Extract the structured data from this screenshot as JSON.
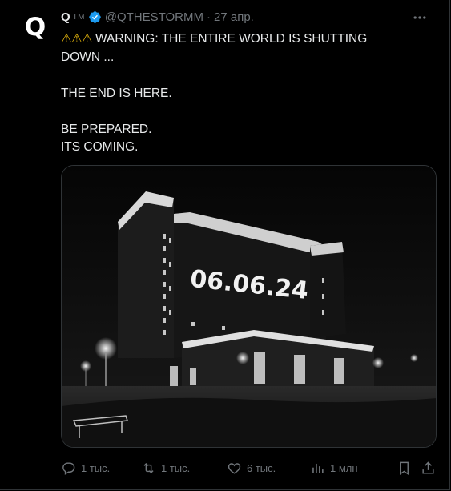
{
  "tweet": {
    "avatar_letter": "Q",
    "display_name": "Q",
    "name_suffix": "ТМ",
    "handle": "@QTHESTORMM",
    "separator": "·",
    "date": "27 апр.",
    "text_lines": [
      "WARNING: THE ENTIRE WORLD IS SHUTTING",
      "DOWN ...",
      "",
      "THE END IS HERE.",
      "",
      "BE PREPARED.",
      "ITS COMING."
    ],
    "warning_icons": "⚠⚠⚠",
    "image_projection_text": "06.06.24",
    "accent_color": "#1d9bf0"
  },
  "actions": {
    "replies": {
      "icon": "reply-icon",
      "count": "1 тыс."
    },
    "reposts": {
      "icon": "repost-icon",
      "count": "1 тыс."
    },
    "likes": {
      "icon": "heart-icon",
      "count": "6 тыс."
    },
    "views": {
      "icon": "views-icon",
      "count": "1 млн"
    },
    "bookmark": {
      "icon": "bookmark-icon"
    },
    "share": {
      "icon": "share-icon"
    }
  }
}
